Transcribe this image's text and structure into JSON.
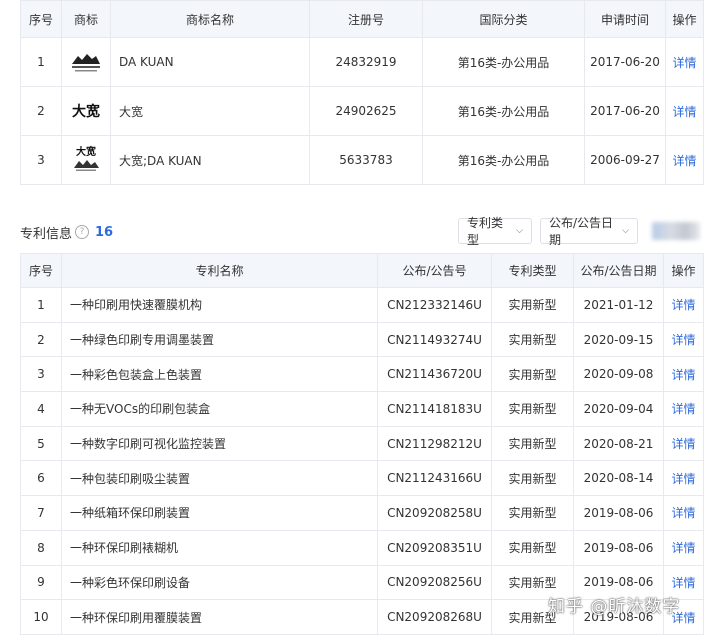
{
  "trademark_table": {
    "headers": [
      "序号",
      "商标",
      "商标名称",
      "注册号",
      "国际分类",
      "申请时间",
      "操作"
    ],
    "rows": [
      {
        "no": "1",
        "logo": "DA KUAN",
        "logo_kind": "graphic",
        "name": "DA KUAN",
        "reg_no": "24832919",
        "class": "第16类-办公用品",
        "date": "2017-06-20",
        "action": "详情"
      },
      {
        "no": "2",
        "logo": "大宽",
        "logo_kind": "text",
        "name": "大宽",
        "reg_no": "24902625",
        "class": "第16类-办公用品",
        "date": "2017-06-20",
        "action": "详情"
      },
      {
        "no": "3",
        "logo": "大宽",
        "logo_kind": "combo",
        "name": "大宽;DA KUAN",
        "reg_no": "5633783",
        "class": "第16类-办公用品",
        "date": "2006-09-27",
        "action": "详情"
      }
    ]
  },
  "patent_section": {
    "title": "专利信息",
    "help_icon": "question-circle-icon",
    "count": "16",
    "filter_type_label": "专利类型",
    "filter_date_label": "公布/公告日期"
  },
  "patent_table": {
    "headers": [
      "序号",
      "专利名称",
      "公布/公告号",
      "专利类型",
      "公布/公告日期",
      "操作"
    ],
    "rows": [
      {
        "no": "1",
        "name": "一种印刷用快速覆膜机构",
        "pub_no": "CN212332146U",
        "type": "实用新型",
        "date": "2021-01-12",
        "action": "详情"
      },
      {
        "no": "2",
        "name": "一种绿色印刷专用调墨装置",
        "pub_no": "CN211493274U",
        "type": "实用新型",
        "date": "2020-09-15",
        "action": "详情"
      },
      {
        "no": "3",
        "name": "一种彩色包装盒上色装置",
        "pub_no": "CN211436720U",
        "type": "实用新型",
        "date": "2020-09-08",
        "action": "详情"
      },
      {
        "no": "4",
        "name": "一种无VOCs的印刷包装盒",
        "pub_no": "CN211418183U",
        "type": "实用新型",
        "date": "2020-09-04",
        "action": "详情"
      },
      {
        "no": "5",
        "name": "一种数字印刷可视化监控装置",
        "pub_no": "CN211298212U",
        "type": "实用新型",
        "date": "2020-08-21",
        "action": "详情"
      },
      {
        "no": "6",
        "name": "一种包装印刷吸尘装置",
        "pub_no": "CN211243166U",
        "type": "实用新型",
        "date": "2020-08-14",
        "action": "详情"
      },
      {
        "no": "7",
        "name": "一种纸箱环保印刷装置",
        "pub_no": "CN209208258U",
        "type": "实用新型",
        "date": "2019-08-06",
        "action": "详情"
      },
      {
        "no": "8",
        "name": "一种环保印刷裱糊机",
        "pub_no": "CN209208351U",
        "type": "实用新型",
        "date": "2019-08-06",
        "action": "详情"
      },
      {
        "no": "9",
        "name": "一种彩色环保印刷设备",
        "pub_no": "CN209208256U",
        "type": "实用新型",
        "date": "2019-08-06",
        "action": "详情"
      },
      {
        "no": "10",
        "name": "一种环保印刷用覆膜装置",
        "pub_no": "CN209208268U",
        "type": "实用新型",
        "date": "2019-08-06",
        "action": "详情"
      }
    ]
  },
  "watermark": "知乎 @昕沐数字",
  "colors": {
    "link": "#2d6bdc",
    "header_bg": "#f3f6fb",
    "border": "#e7e9ee"
  }
}
